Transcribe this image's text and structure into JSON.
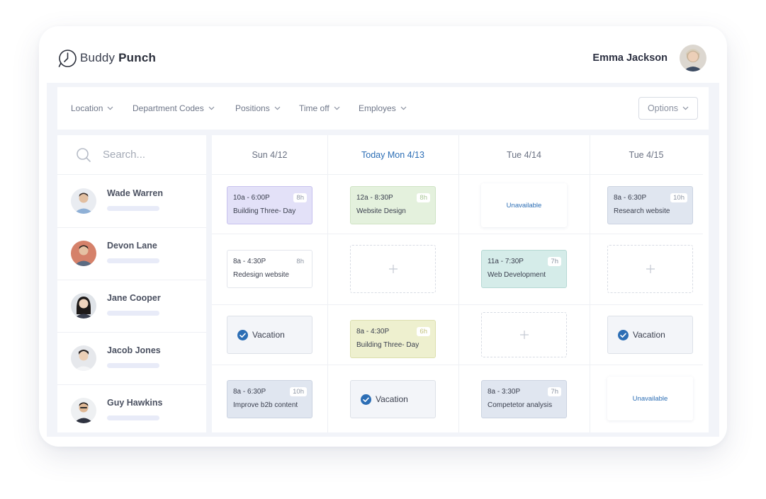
{
  "brand": {
    "name_light": "Buddy",
    "name_bold": "Punch"
  },
  "user": {
    "name": "Emma Jackson"
  },
  "filters": [
    {
      "label": "Location"
    },
    {
      "label": "Department Codes"
    },
    {
      "label": "Positions"
    },
    {
      "label": "Time off"
    },
    {
      "label": "Employes"
    }
  ],
  "options_label": "Options",
  "search": {
    "placeholder": "Search..."
  },
  "employees": [
    {
      "name": "Wade Warren"
    },
    {
      "name": "Devon Lane"
    },
    {
      "name": "Jane Cooper"
    },
    {
      "name": "Jacob Jones"
    },
    {
      "name": "Guy Hawkins"
    }
  ],
  "days": [
    {
      "label": "Sun 4/12"
    },
    {
      "label": "Today Mon 4/13"
    },
    {
      "label": "Tue 4/14"
    },
    {
      "label": "Tue 4/15"
    }
  ],
  "shifts": {
    "r0c0": {
      "time": "10a - 6:00P",
      "hours": "8h",
      "task": "Building Three- Day"
    },
    "r0c1": {
      "time": "12a - 8:30P",
      "hours": "8h",
      "task": "Website Design"
    },
    "r0c2": {
      "label": "Unavailable"
    },
    "r0c3": {
      "time": "8a - 6:30P",
      "hours": "10h",
      "task": "Research website"
    },
    "r1c0": {
      "time": "8a - 4:30P",
      "hours": "8h",
      "task": "Redesign website"
    },
    "r1c2": {
      "time": "11a - 7:30P",
      "hours": "7h",
      "task": "Web Development"
    },
    "r2c0": {
      "label": "Vacation"
    },
    "r2c1": {
      "time": "8a - 4:30P",
      "hours": "6h",
      "task": "Building Three- Day"
    },
    "r2c3": {
      "label": "Vacation"
    },
    "r3c0": {
      "time": "8a - 6:30P",
      "hours": "10h",
      "task": "Improve b2b content"
    },
    "r3c1": {
      "label": "Vacation"
    },
    "r3c2": {
      "time": "8a - 3:30P",
      "hours": "7h",
      "task": "Competetor analysis"
    },
    "r3c3": {
      "label": "Unavailable"
    }
  },
  "colors": {
    "accent": "#2c6eb5",
    "purple_shift": "#e3e1f8",
    "green_shift": "#e4f1dd",
    "slate_shift": "#e0e6f0",
    "teal_shift": "#d5ece9",
    "olive_shift": "#eef0cf"
  }
}
